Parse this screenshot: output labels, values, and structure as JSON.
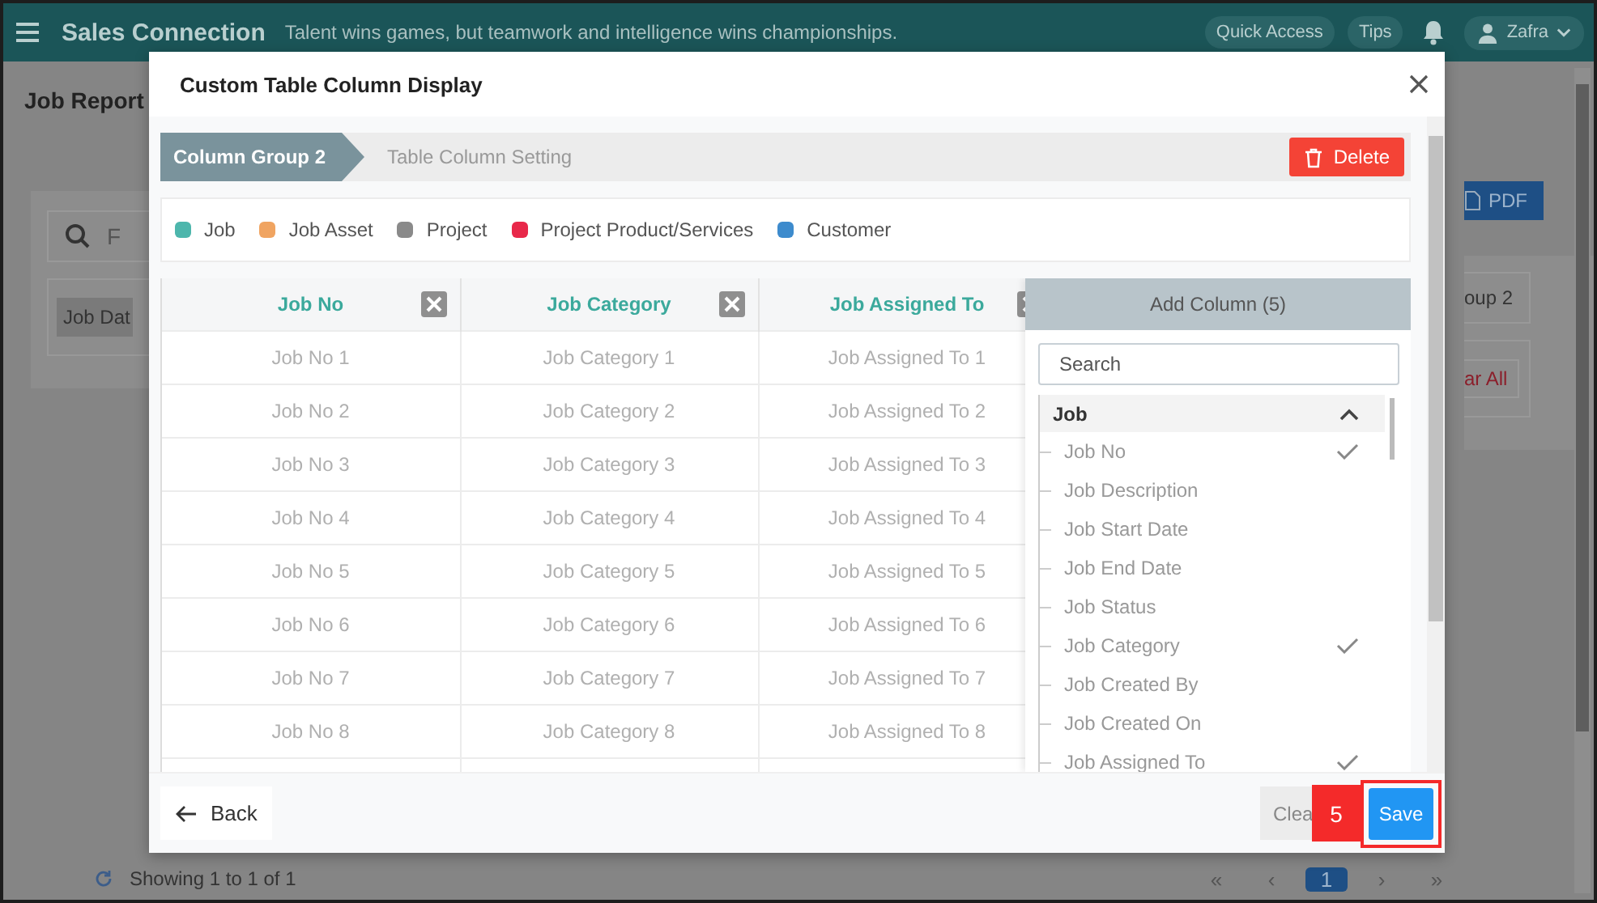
{
  "app": {
    "title": "Sales Connection",
    "tagline": "Talent wins games, but teamwork and intelligence wins championships.",
    "quick_access": "Quick Access",
    "tips": "Tips",
    "user": "Zafra"
  },
  "page": {
    "title": "Job Report",
    "search_placeholder": "F",
    "filter_chip": "Job Dat",
    "pdf_button": "PDF",
    "group_button": "oup 2",
    "clear_all_button": "ar All",
    "showing": "Showing 1 to 1 of 1",
    "pagination": [
      {
        "label": "«",
        "selected": false
      },
      {
        "label": "‹",
        "selected": false
      },
      {
        "label": "1",
        "selected": true
      },
      {
        "label": "›",
        "selected": false
      },
      {
        "label": "»",
        "selected": false
      }
    ]
  },
  "dialog": {
    "title": "Custom Table Column Display",
    "breadcrumb": [
      {
        "label": "Column Group 2",
        "selected": true
      },
      {
        "label": "Table Column Setting",
        "selected": false
      }
    ],
    "delete_button": "Delete",
    "legend": [
      {
        "label": "Job",
        "color": "#4db6ac"
      },
      {
        "label": "Job Asset",
        "color": "#f0a461"
      },
      {
        "label": "Project",
        "color": "#8a8a8a"
      },
      {
        "label": "Project Product/Services",
        "color": "#e8284a"
      },
      {
        "label": "Customer",
        "color": "#3d8bcd"
      }
    ],
    "table": {
      "columns": [
        "Job No",
        "Job Category",
        "Job Assigned To"
      ],
      "rows": [
        [
          "Job No 1",
          "Job Category 1",
          "Job Assigned To 1"
        ],
        [
          "Job No 2",
          "Job Category 2",
          "Job Assigned To 2"
        ],
        [
          "Job No 3",
          "Job Category 3",
          "Job Assigned To 3"
        ],
        [
          "Job No 4",
          "Job Category 4",
          "Job Assigned To 4"
        ],
        [
          "Job No 5",
          "Job Category 5",
          "Job Assigned To 5"
        ],
        [
          "Job No 6",
          "Job Category 6",
          "Job Assigned To 6"
        ],
        [
          "Job No 7",
          "Job Category 7",
          "Job Assigned To 7"
        ],
        [
          "Job No 8",
          "Job Category 8",
          "Job Assigned To 8"
        ]
      ]
    },
    "add_column": {
      "title": "Add Column (5)",
      "search_placeholder": "Search",
      "group": {
        "label": "Job",
        "expanded": true,
        "children": [
          {
            "label": "Job No",
            "checked": true
          },
          {
            "label": "Job Description",
            "checked": false
          },
          {
            "label": "Job Start Date",
            "checked": false
          },
          {
            "label": "Job End Date",
            "checked": false
          },
          {
            "label": "Job Status",
            "checked": false
          },
          {
            "label": "Job Category",
            "checked": true
          },
          {
            "label": "Job Created By",
            "checked": false
          },
          {
            "label": "Job Created On",
            "checked": false
          },
          {
            "label": "Job Assigned To",
            "checked": true
          }
        ]
      }
    },
    "back_button": "Back",
    "clear_button": "Clea",
    "save_button": "Save",
    "annotation": {
      "label": "5"
    }
  }
}
